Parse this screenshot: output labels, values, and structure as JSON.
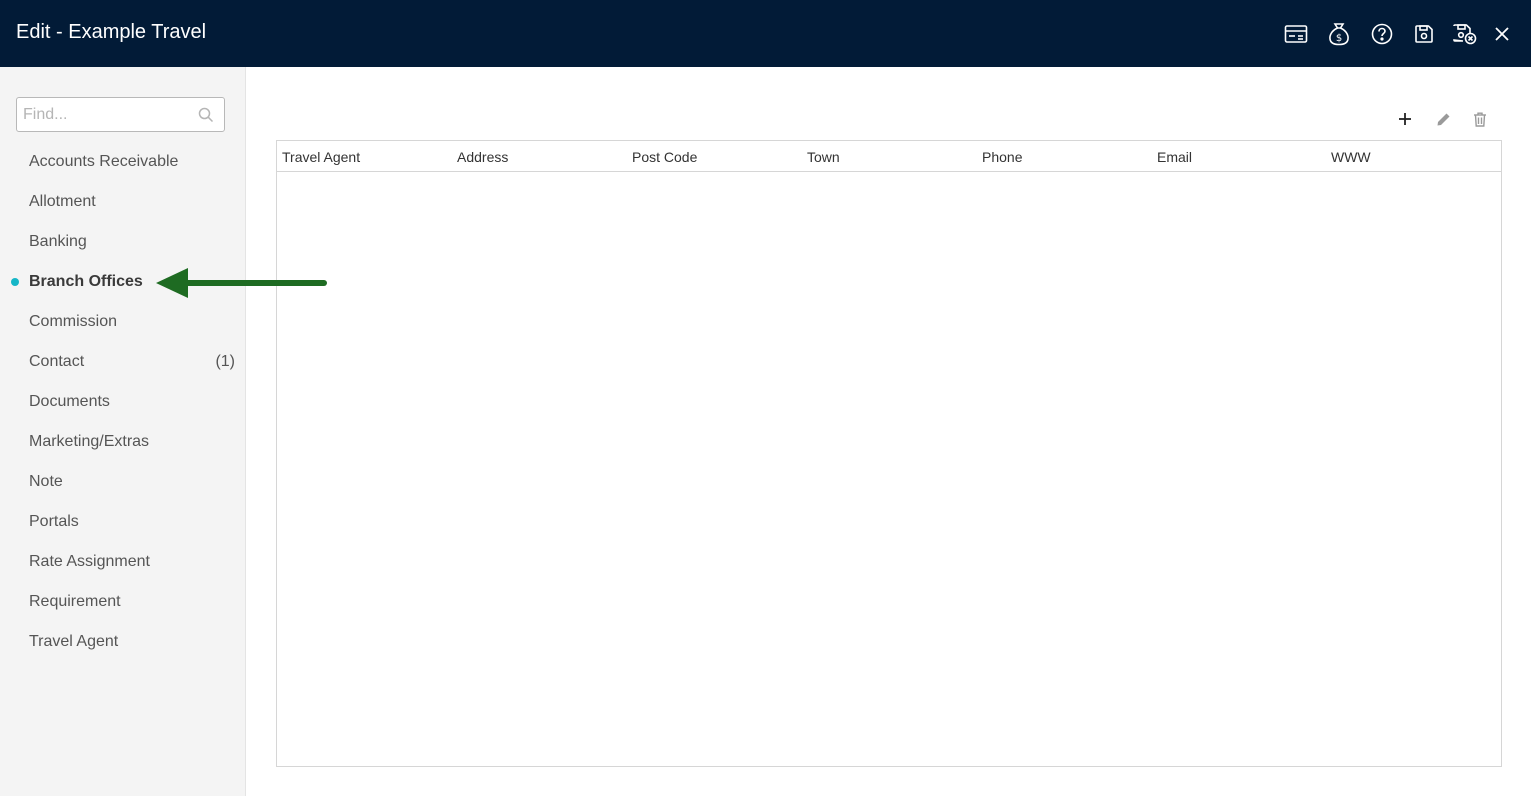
{
  "window": {
    "title": "Edit - Example Travel",
    "actions": [
      {
        "name": "card-icon"
      },
      {
        "name": "money-bag-icon"
      },
      {
        "name": "help-icon"
      },
      {
        "name": "save-icon"
      },
      {
        "name": "save-close-icon"
      },
      {
        "name": "close-icon"
      }
    ]
  },
  "sidebar": {
    "search": {
      "placeholder": "Find...",
      "value": ""
    },
    "items": [
      {
        "label": "Accounts Receivable",
        "count": ""
      },
      {
        "label": "Allotment",
        "count": ""
      },
      {
        "label": "Banking",
        "count": ""
      },
      {
        "label": "Branch Offices",
        "count": "",
        "active": true
      },
      {
        "label": "Commission",
        "count": ""
      },
      {
        "label": "Contact",
        "count": "(1)"
      },
      {
        "label": "Documents",
        "count": ""
      },
      {
        "label": "Marketing/Extras",
        "count": ""
      },
      {
        "label": "Note",
        "count": ""
      },
      {
        "label": "Portals",
        "count": ""
      },
      {
        "label": "Rate Assignment",
        "count": ""
      },
      {
        "label": "Requirement",
        "count": ""
      },
      {
        "label": "Travel Agent",
        "count": ""
      }
    ]
  },
  "toolbar": {
    "buttons": [
      {
        "name": "add-icon"
      },
      {
        "name": "edit-icon"
      },
      {
        "name": "delete-icon"
      }
    ]
  },
  "grid": {
    "columns": [
      "Travel Agent",
      "Address",
      "Post Code",
      "Town",
      "Phone",
      "Email",
      "WWW"
    ],
    "rows": []
  },
  "colors": {
    "titlebar": "#021b37",
    "active_dot": "#16b6c7",
    "annotation_arrow": "#1e6b22"
  }
}
